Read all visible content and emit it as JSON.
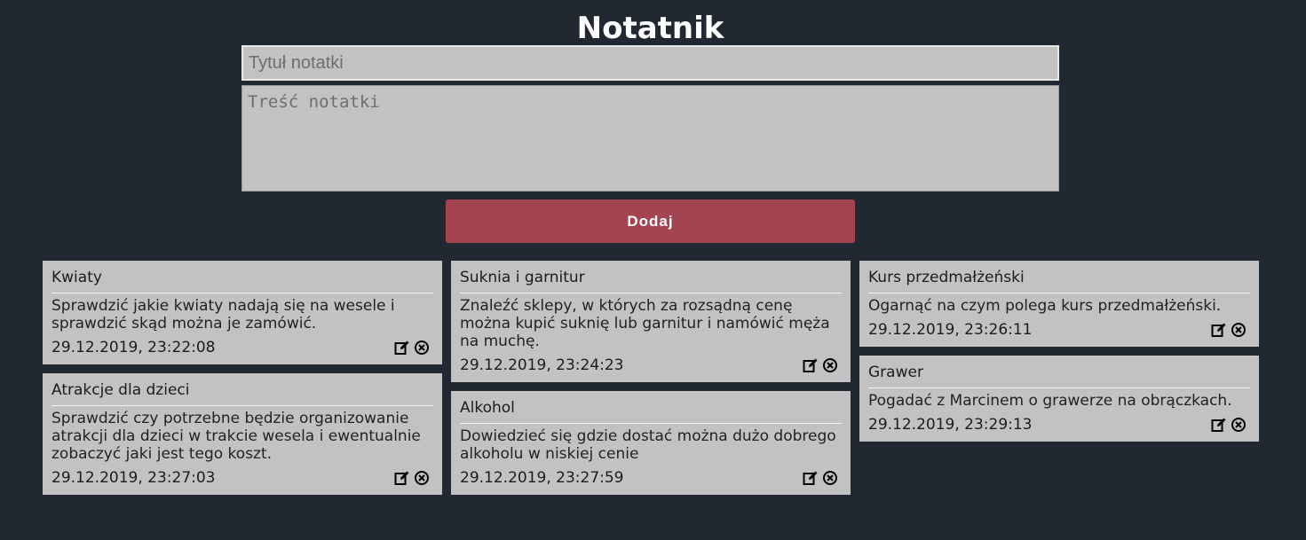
{
  "header": {
    "title": "Notatnik"
  },
  "form": {
    "title_placeholder": "Tytuł notatki",
    "title_value": "",
    "content_placeholder": "Treść notatki",
    "content_value": "",
    "add_label": "Dodaj"
  },
  "notes": {
    "col1": [
      {
        "title": "Kwiaty",
        "body": "Sprawdzić jakie kwiaty nadają się na wesele i sprawdzić skąd można je zamówić.",
        "date": "29.12.2019, 23:22:08"
      },
      {
        "title": "Atrakcje dla dzieci",
        "body": "Sprawdzić czy potrzebne będzie organizowanie atrakcji dla dzieci w trakcie wesela i ewentualnie zobaczyć jaki jest tego koszt.",
        "date": "29.12.2019, 23:27:03"
      }
    ],
    "col2": [
      {
        "title": "Suknia i garnitur",
        "body": "Znaleźć sklepy, w których za rozsądną cenę można kupić suknię lub garnitur i namówić męża na muchę.",
        "date": "29.12.2019, 23:24:23"
      },
      {
        "title": "Alkohol",
        "body": "Dowiedzieć się gdzie dostać można dużo dobrego alkoholu w niskiej cenie",
        "date": "29.12.2019, 23:27:59"
      }
    ],
    "col3": [
      {
        "title": "Kurs przedmałżeński",
        "body": "Ogarnąć na czym polega kurs przedmałżeński.",
        "date": "29.12.2019, 23:26:11"
      },
      {
        "title": "Grawer",
        "body": "Pogadać z Marcinem o grawerze na obrączkach.",
        "date": "29.12.2019, 23:29:13"
      }
    ]
  },
  "icons": {
    "edit": "edit-icon",
    "delete": "delete-icon"
  },
  "colors": {
    "background": "#222831",
    "card": "#c2c2c2",
    "accent": "#a44451"
  }
}
